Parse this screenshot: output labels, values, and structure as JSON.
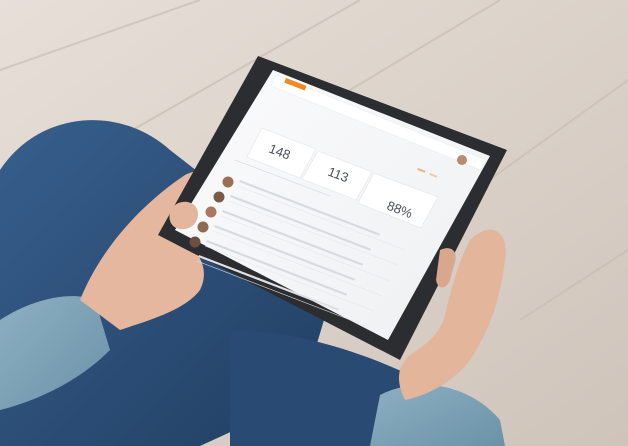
{
  "app": {
    "logo_text": "",
    "header_title": "",
    "page_title": "",
    "section_label": ""
  },
  "stats": [
    {
      "label": "",
      "value": "148"
    },
    {
      "label": "",
      "value": "113"
    },
    {
      "label": "",
      "value": "88%"
    }
  ],
  "table": {
    "rows": 6
  },
  "colors": {
    "accent": "#f08a24",
    "floor": "#d9cfc6",
    "jeans": "#2d4f78",
    "sweater": "#7ea3b6",
    "skin": "#e7b9a0",
    "tablet_frame": "#2b2d31"
  }
}
